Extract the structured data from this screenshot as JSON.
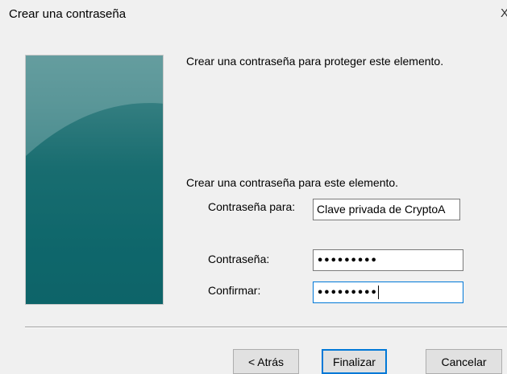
{
  "window": {
    "title": "Crear una contraseña",
    "close_glyph": "X"
  },
  "content": {
    "intro": "Crear una contraseña para proteger este elemento.",
    "section_title": "Crear una contraseña para este elemento.",
    "password_for_label": "Contraseña para:",
    "password_for_value": "Clave privada de CryptoA",
    "password_label": "Contraseña:",
    "password_value": "•••••••••",
    "confirm_label": "Confirmar:",
    "confirm_value": "•••••••••"
  },
  "buttons": {
    "back": "< Atrás",
    "finish": "Finalizar",
    "cancel": "Cancelar"
  },
  "colors": {
    "panel_top": "#5f9799",
    "panel_bottom": "#0d6167",
    "focus_border": "#0078d7"
  }
}
